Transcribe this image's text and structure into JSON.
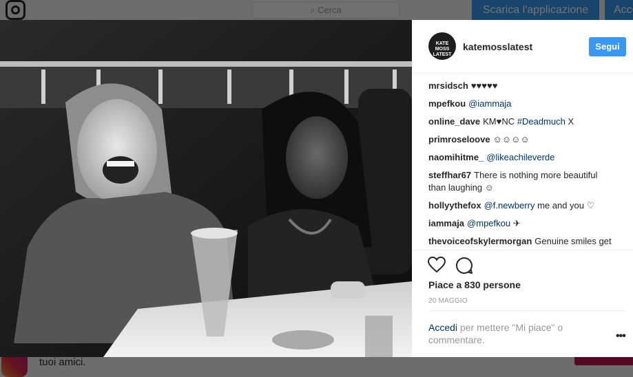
{
  "background": {
    "search_placeholder": "Cerca",
    "download_button": "Scarica l'applicazione",
    "access_button": "Acce",
    "footer_text": "tuoi amici."
  },
  "post": {
    "username": "katemosslatest",
    "avatar_text": "KATE MOSS LATEST",
    "follow_label": "Segui",
    "comments": [
      {
        "user": "mrsidsch",
        "parts": [
          {
            "text": "♥♥♥♥♥",
            "tag": false
          }
        ]
      },
      {
        "user": "mpefkou",
        "parts": [
          {
            "text": "@iammaja",
            "tag": true
          }
        ]
      },
      {
        "user": "online_dave",
        "parts": [
          {
            "text": "KM♥NC ",
            "tag": false
          },
          {
            "text": "#Deadmuch",
            "tag": true
          },
          {
            "text": " X",
            "tag": false
          }
        ]
      },
      {
        "user": "primroseloove",
        "parts": [
          {
            "text": "☺☺☺☺",
            "tag": false
          }
        ]
      },
      {
        "user": "naomihitme_",
        "parts": [
          {
            "text": "@likeachileverde",
            "tag": true
          }
        ]
      },
      {
        "user": "steffhar67",
        "parts": [
          {
            "text": "There is nothing more beautiful than laughing ☺",
            "tag": false
          }
        ]
      },
      {
        "user": "hollyythefox",
        "parts": [
          {
            "text": "@f.newberry",
            "tag": true
          },
          {
            "text": " me and you ♡",
            "tag": false
          }
        ]
      },
      {
        "user": "iammaja",
        "parts": [
          {
            "text": "@mpefkou",
            "tag": true
          },
          {
            "text": " ✈",
            "tag": false
          }
        ]
      },
      {
        "user": "thevoiceofskylermorgan",
        "parts": [
          {
            "text": "Genuine smiles get me every time!",
            "tag": false
          }
        ]
      }
    ],
    "likes_text": "Piace a 830 persone",
    "date": "20 MAGGIO",
    "login_link": "Accedi",
    "login_rest": " per mettere \"Mi piace\" o commentare.",
    "more_label": "•••"
  },
  "colors": {
    "accent": "#3897f0",
    "link": "#003569",
    "muted": "#999999"
  },
  "icons": [
    "instagram-logo-icon",
    "search-icon",
    "heart-icon",
    "comment-icon",
    "more-options-icon"
  ]
}
